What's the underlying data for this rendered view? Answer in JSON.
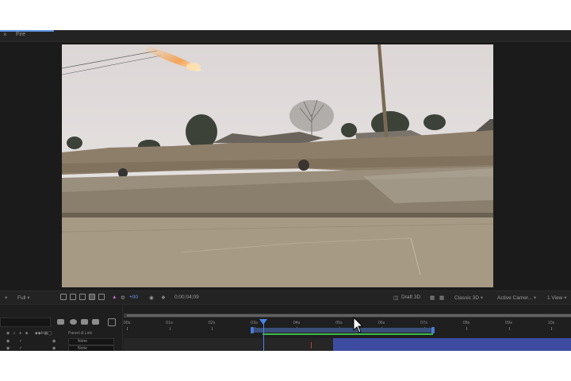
{
  "tab": {
    "close_glyph": "×",
    "label": "Fire",
    "accent_color": "#5a8fd9"
  },
  "viewer": {
    "scene": "Dusty roadside with a dirt embankment, trees, debris, utility pole, and a flaming projectile streaking in from the top-left",
    "fireball_color": "#f2a35a"
  },
  "viewer_toolbar": {
    "left_dropdown": "",
    "resolution": "Full",
    "channel_label": "+00",
    "timecode": "0;00;04;09",
    "draft3d": "Draft 3D",
    "renderer": "Classic 3D",
    "camera": "Active Camer...",
    "views": "1 View"
  },
  "timeline": {
    "ruler_labels": [
      "00s",
      "01s",
      "02s",
      "03s",
      "04s",
      "05s",
      "06s",
      "07s",
      "08s",
      "09s",
      "10s"
    ],
    "columns": {
      "parent_link": "Parent & Link"
    },
    "layers": [
      {
        "parent": "None"
      },
      {
        "parent": "None"
      }
    ],
    "playhead_color": "#4a86e8",
    "range_color": "#4a79d8",
    "motion_path_color": "#3fbd4b",
    "layer_bar_color": "#3d4ca0"
  },
  "icons": [
    "close-icon",
    "toggle-view-icon",
    "grid-icon",
    "mask-icon",
    "color-icon",
    "exposure-icon",
    "camera-icon",
    "snapshot-icon",
    "draft3d-icon",
    "search-icon",
    "comp-mini-flowchart-icon",
    "eye-icon",
    "audio-icon",
    "solo-icon",
    "lock-icon",
    "mouse-cursor-icon"
  ]
}
